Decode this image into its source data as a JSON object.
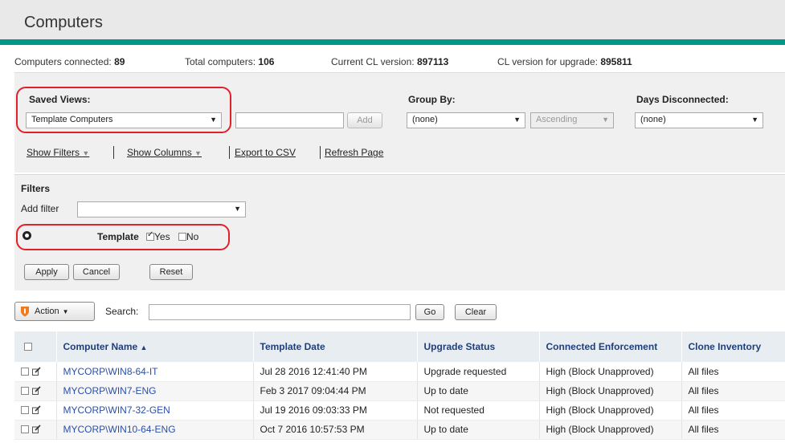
{
  "header": {
    "title": "Computers"
  },
  "stats": {
    "connected_label": "Computers connected:",
    "connected_value": "89",
    "total_label": "Total computers:",
    "total_value": "106",
    "current_cl_label": "Current CL version:",
    "current_cl_value": "897113",
    "upgrade_cl_label": "CL version for upgrade:",
    "upgrade_cl_value": "895811"
  },
  "saved_views": {
    "label": "Saved Views:",
    "value": "Template Computers",
    "add_button": "Add"
  },
  "group_by": {
    "label": "Group By:",
    "value": "(none)",
    "order": "Ascending"
  },
  "days_disconnected": {
    "label": "Days Disconnected:",
    "value": "(none)"
  },
  "links": {
    "show_filters": "Show Filters",
    "show_columns": "Show Columns",
    "export_csv": "Export to CSV",
    "refresh": "Refresh Page"
  },
  "filters": {
    "title": "Filters",
    "add_filter_label": "Add filter",
    "template_label": "Template",
    "yes_label": "Yes",
    "no_label": "No",
    "apply": "Apply",
    "cancel": "Cancel",
    "reset": "Reset"
  },
  "toolbar": {
    "action": "Action",
    "search_label": "Search:",
    "go": "Go",
    "clear": "Clear"
  },
  "table": {
    "headers": {
      "name": "Computer Name",
      "date": "Template Date",
      "status": "Upgrade Status",
      "enforcement": "Connected Enforcement",
      "clone": "Clone Inventory"
    },
    "rows": [
      {
        "name": "MYCORP\\WIN8-64-IT",
        "date": "Jul 28 2016 12:41:40 PM",
        "status": "Upgrade requested",
        "enforcement": "High (Block Unapproved)",
        "clone": "All files"
      },
      {
        "name": "MYCORP\\WIN7-ENG",
        "date": "Feb 3 2017 09:04:44 PM",
        "status": "Up to date",
        "enforcement": "High (Block Unapproved)",
        "clone": "All files"
      },
      {
        "name": "MYCORP\\WIN7-32-GEN",
        "date": "Jul 19 2016 09:03:33 PM",
        "status": "Not requested",
        "enforcement": "High (Block Unapproved)",
        "clone": "All files"
      },
      {
        "name": "MYCORP\\WIN10-64-ENG",
        "date": "Oct 7 2016 10:57:53 PM",
        "status": "Up to date",
        "enforcement": "High (Block Unapproved)",
        "clone": "All files"
      }
    ]
  },
  "colors": {
    "accent": "#00968a",
    "highlight": "#e0202a",
    "link": "#2b4fa8",
    "action_icon": "#f07a1c"
  }
}
